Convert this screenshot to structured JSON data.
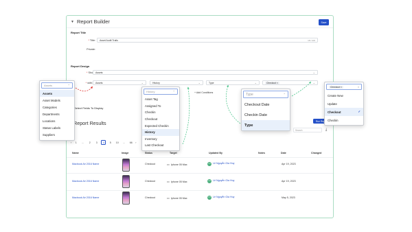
{
  "builder": {
    "title": "Report Builder",
    "save_label": "Save",
    "report_title_section": "Report Title",
    "title_label": "Title:",
    "title_value": "Asset Audit Trails",
    "title_count": "18 / 100",
    "private_label": "Private:",
    "report_design_section": "Report Design",
    "show_label": "Show:",
    "show_value": "Assets",
    "with_label": "with:",
    "with_value": "Assets",
    "f2_value": "History",
    "f3_value": "Type",
    "f4_tag": "Checkout",
    "add_conditions": "Add Conditions",
    "select_fields": "Select Fields To Display"
  },
  "results": {
    "title": "Report Results",
    "run_report": "Run Report",
    "search_placeholder": "Search",
    "download_icon": "download-icon",
    "pagination": [
      "1",
      "...",
      "2",
      "3",
      "4",
      "5",
      "10",
      "...",
      "66"
    ],
    "active_page": "4",
    "columns": [
      "Name",
      "Image",
      "Status",
      "Target",
      "Updated By",
      "Notes",
      "Date",
      "Changed"
    ],
    "rows": [
      {
        "name": "Macbook Air 2016 Name",
        "status": "Checkout",
        "target": "Iphone 05 Max",
        "user": "Lê Nguyễn Gia Huy",
        "initials": "LH",
        "date": "Apr 19, 2023"
      },
      {
        "name": "Macbook Air 2016 Name",
        "status": "Checkout",
        "target": "Iphone 05 Max",
        "user": "Lê Nguyễn Gia Huy",
        "initials": "LH",
        "date": "Apr 19, 2023"
      },
      {
        "name": "Macbook Air 2016 Name",
        "status": "Checkout",
        "target": "Iphone 05 Max",
        "user": "Lê Nguyễn Gia Huy",
        "initials": "LH",
        "date": "May 5, 2023"
      }
    ]
  },
  "dropdowns": {
    "assets": {
      "placeholder": "Assets",
      "options": [
        "Assets",
        "Asset Models",
        "Categories",
        "Departments",
        "Locations",
        "Status Labels",
        "Suppliers"
      ],
      "highlighted": "Assets"
    },
    "history": {
      "placeholder": "History",
      "options": [
        "Asset Tag",
        "Assigned To",
        "Checkin",
        "Checkout",
        "Expected Checkin",
        "History",
        "Inventory",
        "Last Checkout"
      ],
      "highlighted": "History"
    },
    "type": {
      "placeholder": "Type",
      "options": [
        "Checkout Date",
        "Checkin Date",
        "Type"
      ],
      "highlighted": "Type"
    },
    "checkout": {
      "tag": "Checkout",
      "options": [
        "Create New",
        "Update",
        "Checkout",
        "Checkin"
      ],
      "highlighted": "Checkout"
    }
  },
  "colors": {
    "accent": "#2450c8",
    "border_green": "#a9dcc2",
    "arrow_green": "#4fc68d",
    "arrow_red": "#e0332f"
  }
}
